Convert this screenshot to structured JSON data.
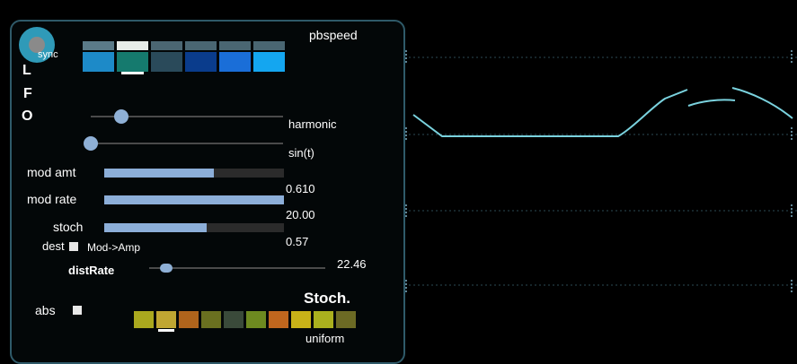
{
  "lfo": {
    "letters": [
      "L",
      "F",
      "O"
    ],
    "sync_label": "sync",
    "title": "pbspeed",
    "top_palette": [
      {
        "top": "#5b7a88",
        "bottom": "#1d8ac8"
      },
      {
        "top": "#e8ece8",
        "bottom": "#157a6e"
      },
      {
        "top": "#4b6672",
        "bottom": "#2a4a5a"
      },
      {
        "top": "#4a6672",
        "bottom": "#0a3c8c"
      },
      {
        "top": "#4a6672",
        "bottom": "#1a6ed8"
      },
      {
        "top": "#4a6672",
        "bottom": "#14a6f0"
      }
    ],
    "top_palette_selected": 1,
    "shape_slider": {
      "label": "harmonic",
      "value": 0.16
    },
    "func_slider": {
      "label": "sin(t)",
      "value": 0.0
    },
    "mod_amt": {
      "label": "mod amt",
      "value_text": "0.610",
      "value": 0.61
    },
    "mod_rate": {
      "label": "mod rate",
      "value_text": "20.00",
      "value": 1.0
    },
    "stoch": {
      "label": "stoch",
      "value_text": "0.57",
      "value": 0.57
    },
    "dest": {
      "label": "dest",
      "value": "Mod->Amp"
    },
    "dist_rate": {
      "label": "distRate",
      "value_text": "22.46",
      "value": 0.06
    },
    "stoch_section": {
      "title": "Stoch.",
      "mode": "uniform"
    },
    "abs_label": "abs",
    "bottom_palette": [
      "#aaa81e",
      "#c0a632",
      "#b0641c",
      "#6a7020",
      "#3a4a3a",
      "#6e8a20",
      "#c0661e",
      "#c8b218",
      "#aab01e",
      "#6c6a24"
    ],
    "bottom_palette_selected": 1
  },
  "colors": {
    "accent": "#2f9ab8",
    "waveform": "#7ad2de",
    "panel_border": "#2f5a69",
    "bar_fill": "#8caed8"
  }
}
